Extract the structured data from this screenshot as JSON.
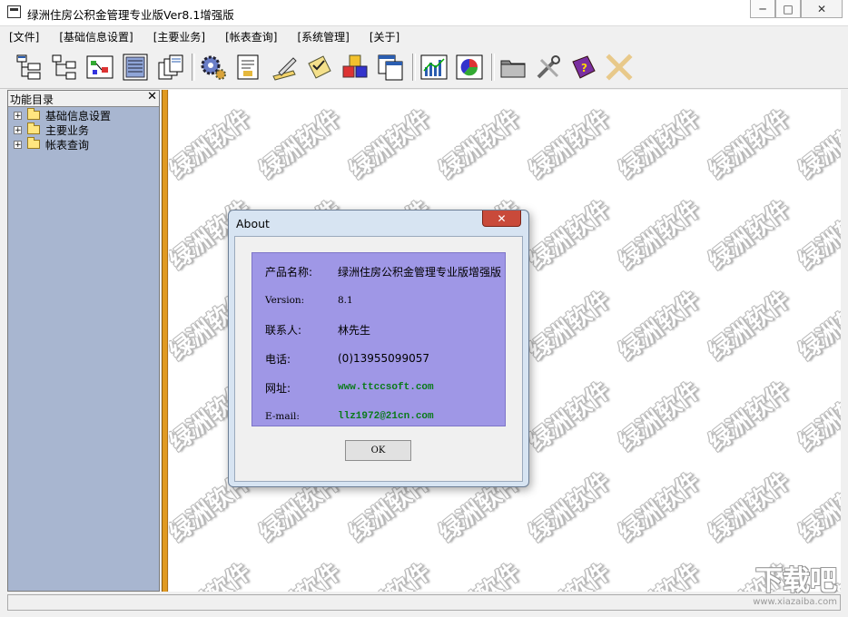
{
  "window": {
    "title": "绿洲住房公积金管理专业版Ver8.1增强版",
    "minimize_label": "─",
    "maximize_label": "□",
    "close_label": "✕"
  },
  "menu": {
    "items": [
      {
        "label": "[文件]"
      },
      {
        "label": "[基础信息设置]"
      },
      {
        "label": "[主要业务]"
      },
      {
        "label": "[帐表查询]"
      },
      {
        "label": "[系统管理]"
      },
      {
        "label": "[关于]"
      }
    ]
  },
  "toolbar": {
    "icons": [
      "tree-org-icon",
      "tree-structure-icon",
      "form-diagram-icon",
      "document-list-icon",
      "stacked-pages-icon",
      "gear-settings-icon",
      "edit-document-icon",
      "pen-signature-icon",
      "checklist-icon",
      "colored-cubes-icon",
      "window-layers-icon",
      "bar-chart-icon",
      "pie-chart-icon",
      "folder-icon",
      "tools-icon",
      "help-book-icon",
      "exit-x-icon"
    ]
  },
  "sidebar": {
    "title": "功能目录",
    "close_label": "✕",
    "items": [
      {
        "label": "基础信息设置"
      },
      {
        "label": "主要业务"
      },
      {
        "label": "帐表查询"
      }
    ]
  },
  "watermark": {
    "text": "绿洲软件"
  },
  "dialog": {
    "title": "About",
    "close_label": "✕",
    "rows": [
      {
        "label": "产品名称:",
        "value": "绿洲住房公积金管理专业版增强版"
      },
      {
        "label": "Version:",
        "value": "8.1"
      },
      {
        "label": "联系人:",
        "value": "林先生"
      },
      {
        "label": "电话:",
        "value": "(0)13955099057"
      },
      {
        "label": "网址:",
        "value": "www.ttccsoft.com"
      },
      {
        "label": "E-mail:",
        "value": "llz1972@21cn.com"
      }
    ],
    "ok_label": "OK"
  },
  "corner": {
    "logo": "下载吧",
    "url": "www.xiazaiba.com"
  },
  "colors": {
    "sidebar_bg": "#a8b6d0",
    "splitter": "#e09a22",
    "info_panel": "#9f97e6",
    "link_green": "#0a7a1a",
    "dialog_frame": "#d7e4f2"
  }
}
